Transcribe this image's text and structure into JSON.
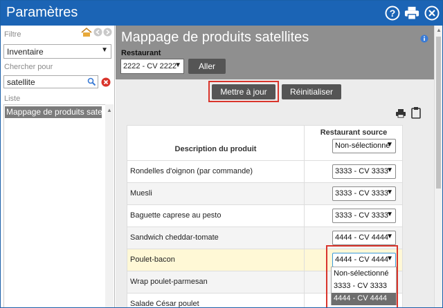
{
  "window": {
    "title": "Paramètres"
  },
  "left": {
    "filter_label": "Filtre",
    "filter_value": "Inventaire",
    "search_label": "Chercher pour",
    "search_value": "satellite",
    "list_label": "Liste",
    "list_items": [
      "Mappage de produits satellite"
    ]
  },
  "main": {
    "title": "Mappage de produits satellites",
    "restaurant_label": "Restaurant",
    "restaurant_value": "2222 - CV 2222",
    "go_button": "Aller",
    "update_button": "Mettre à jour",
    "reset_button": "Réinitialiser"
  },
  "table": {
    "col_description": "Description du produit",
    "col_source": "Restaurant source",
    "header_select": "Non-sélectionné",
    "rows": [
      {
        "product": "Rondelles d'oignon (par commande)",
        "source": "3333 - CV 3333"
      },
      {
        "product": "Muesli",
        "source": "3333 - CV 3333"
      },
      {
        "product": "Baguette caprese au pesto",
        "source": "3333 - CV 3333"
      },
      {
        "product": "Sandwich cheddar-tomate",
        "source": "4444 - CV 4444"
      },
      {
        "product": "Poulet-bacon",
        "source": "4444 - CV 4444"
      },
      {
        "product": "Wrap poulet-parmesan",
        "source": ""
      },
      {
        "product": "Salade César poulet",
        "source": ""
      }
    ]
  },
  "dropdown": {
    "options": [
      "Non-sélectionné",
      "3333 - CV 3333",
      "4444 - CV 4444"
    ],
    "selected_index": 2
  },
  "colors": {
    "titlebar": "#1b64b5",
    "header": "#8f8f8f",
    "button": "#555555",
    "highlight_row": "#fff8d6",
    "annotation": "#d9342b",
    "selected_option": "#6e6e6e"
  }
}
